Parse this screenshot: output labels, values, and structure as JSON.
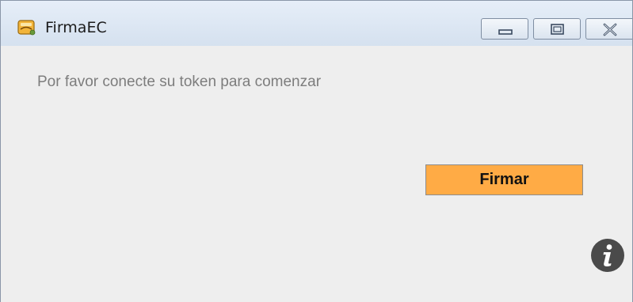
{
  "window": {
    "title": "FirmaEC",
    "app_icon": "firmaec-app-icon",
    "controls": {
      "minimize_icon": "minimize-icon",
      "maximize_icon": "maximize-icon",
      "close_icon": "close-icon"
    }
  },
  "main": {
    "message": "Por favor conecte su token para comenzar",
    "sign_button_label": "Firmar",
    "sign_button_color": "#ffab45",
    "info_icon": "info-icon"
  }
}
